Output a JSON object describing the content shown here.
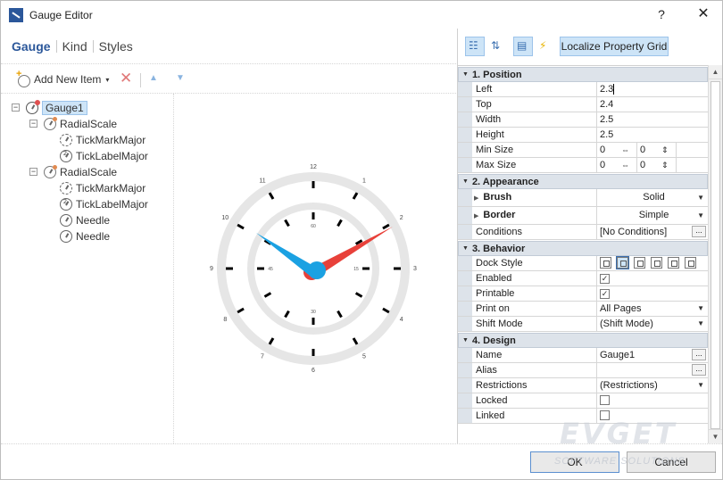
{
  "window": {
    "title": "Gauge Editor",
    "help_label": "?",
    "close_label": "✕"
  },
  "tabs": [
    {
      "label": "Gauge",
      "active": true
    },
    {
      "label": "Kind",
      "active": false
    },
    {
      "label": "Styles",
      "active": false
    }
  ],
  "toolbar": {
    "add_label": "Add New Item",
    "caret": "▾",
    "delete_glyph": "✕",
    "up_glyph": "▲",
    "down_glyph": "▼"
  },
  "tree": [
    {
      "label": "Gauge1",
      "icon": "gauge-icon",
      "level": 0,
      "toggle": "−",
      "selected": true
    },
    {
      "label": "RadialScale",
      "icon": "scale-icon",
      "level": 1,
      "toggle": "−"
    },
    {
      "label": "TickMarkMajor",
      "icon": "tickmark-icon",
      "level": 2
    },
    {
      "label": "TickLabelMajor",
      "icon": "ticklabel-icon",
      "level": 2
    },
    {
      "label": "RadialScale",
      "icon": "scale-icon",
      "level": 1,
      "toggle": "−"
    },
    {
      "label": "TickMarkMajor",
      "icon": "tickmark-icon",
      "level": 2
    },
    {
      "label": "TickLabelMajor",
      "icon": "ticklabel-icon",
      "level": 2
    },
    {
      "label": "Needle",
      "icon": "needle-icon",
      "level": 2
    },
    {
      "label": "Needle",
      "icon": "needle-icon",
      "level": 2
    }
  ],
  "gauge": {
    "outer_labels": [
      "12",
      "1",
      "2",
      "3",
      "4",
      "5",
      "6",
      "7",
      "8",
      "9",
      "10",
      "11"
    ],
    "inner_labels": [
      "60",
      "",
      "",
      "15",
      "",
      "",
      "30",
      "",
      "",
      "45",
      "",
      ""
    ],
    "colors": {
      "track": "#e6e6e6",
      "tick": "#000000",
      "needle_red": "#e8413a",
      "needle_blue": "#1ba1e2"
    }
  },
  "property_toolbar": {
    "localize_label": "Localize Property Grid"
  },
  "categories": [
    {
      "name": "1. Position",
      "rows": [
        {
          "name": "Left",
          "value": "2.3",
          "type": "text",
          "caret": true
        },
        {
          "name": "Top",
          "value": "2.4",
          "type": "text"
        },
        {
          "name": "Width",
          "value": "2.5",
          "type": "text"
        },
        {
          "name": "Height",
          "value": "2.5",
          "type": "text"
        },
        {
          "name": "Min Size",
          "type": "size",
          "w": "0",
          "h": "0"
        },
        {
          "name": "Max Size",
          "type": "size",
          "w": "0",
          "h": "0"
        }
      ]
    },
    {
      "name": "2. Appearance",
      "rows": [
        {
          "name": "Brush",
          "value": "Solid",
          "type": "expand"
        },
        {
          "name": "Border",
          "value": "Simple",
          "type": "expand"
        },
        {
          "name": "Conditions",
          "value": "[No Conditions]",
          "type": "ellipsis"
        }
      ]
    },
    {
      "name": "3. Behavior",
      "rows": [
        {
          "name": "Dock Style",
          "type": "dock"
        },
        {
          "name": "Enabled",
          "type": "check",
          "checked": true
        },
        {
          "name": "Printable",
          "type": "check",
          "checked": true
        },
        {
          "name": "Print on",
          "value": "All Pages",
          "type": "dropdown"
        },
        {
          "name": "Shift Mode",
          "value": "(Shift Mode)",
          "type": "dropdown"
        }
      ]
    },
    {
      "name": "4. Design",
      "rows": [
        {
          "name": "Name",
          "value": "Gauge1",
          "type": "ellipsis"
        },
        {
          "name": "Alias",
          "value": "",
          "type": "ellipsis"
        },
        {
          "name": "Restrictions",
          "value": "(Restrictions)",
          "type": "dropdown"
        },
        {
          "name": "Locked",
          "type": "check",
          "checked": false
        },
        {
          "name": "Linked",
          "type": "check",
          "checked": false
        }
      ]
    }
  ],
  "buttons": {
    "ok": "OK",
    "cancel": "Cancel"
  },
  "watermark": {
    "main": "EVGET",
    "sub": "SOFTWARE SOLUTIONS"
  }
}
